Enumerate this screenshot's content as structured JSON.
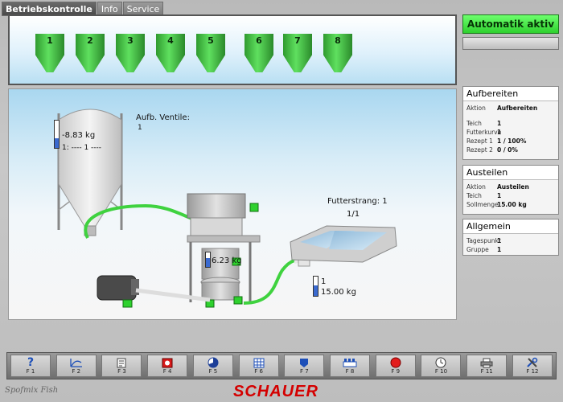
{
  "tabs": [
    {
      "label": "Betriebskontrolle"
    },
    {
      "label": "Info"
    },
    {
      "label": "Service"
    }
  ],
  "silos": [
    "1",
    "2",
    "3",
    "4",
    "5",
    "6",
    "7",
    "8"
  ],
  "process": {
    "silo_weight": "-8.83 kg",
    "silo_line": "1: ---- 1 ----",
    "ventile_label": "Aufb. Ventile:",
    "ventile_value": "1",
    "mixer_weight": "6.23 kg",
    "strang_label": "Futterstrang: 1",
    "strang_ratio": "1/1",
    "tank_num": "1",
    "tank_weight": "15.00 kg",
    "silo_weight_fill": 0.35,
    "mixer_fill": 0.6,
    "tank_fill": 0.55
  },
  "right": {
    "auto_label": "Automatik aktiv",
    "aufbereiten": {
      "title": "Aufbereiten",
      "aktion_k": "Aktion",
      "aktion_v": "Aufbereiten",
      "teich_k": "Teich",
      "teich_v": "1",
      "kurve_k": "Futterkurve",
      "kurve_v": "1",
      "rez1_k": "Rezept 1",
      "rez1_v": "1 / 100%",
      "rez2_k": "Rezept 2",
      "rez2_v": "0 / 0%"
    },
    "austeilen": {
      "title": "Austeilen",
      "aktion_k": "Aktion",
      "aktion_v": "Austeilen",
      "teich_k": "Teich",
      "teich_v": "1",
      "soll_k": "Sollmenge",
      "soll_v": "15.00 kg"
    },
    "allgemein": {
      "title": "Allgemein",
      "tag_k": "Tagespunkt",
      "tag_v": "1",
      "grp_k": "Gruppe",
      "grp_v": "1"
    }
  },
  "fkeys": [
    "F 1",
    "F 2",
    "F 3",
    "F 4",
    "F 5",
    "F 6",
    "F 7",
    "F 8",
    "F 9",
    "F 10",
    "F 11",
    "F 12"
  ],
  "footer": {
    "left": "Spofmix Fish",
    "logo": "SCHAUER"
  },
  "colors": {
    "accent_green": "#3fd23f",
    "brand_red": "#d40000"
  }
}
